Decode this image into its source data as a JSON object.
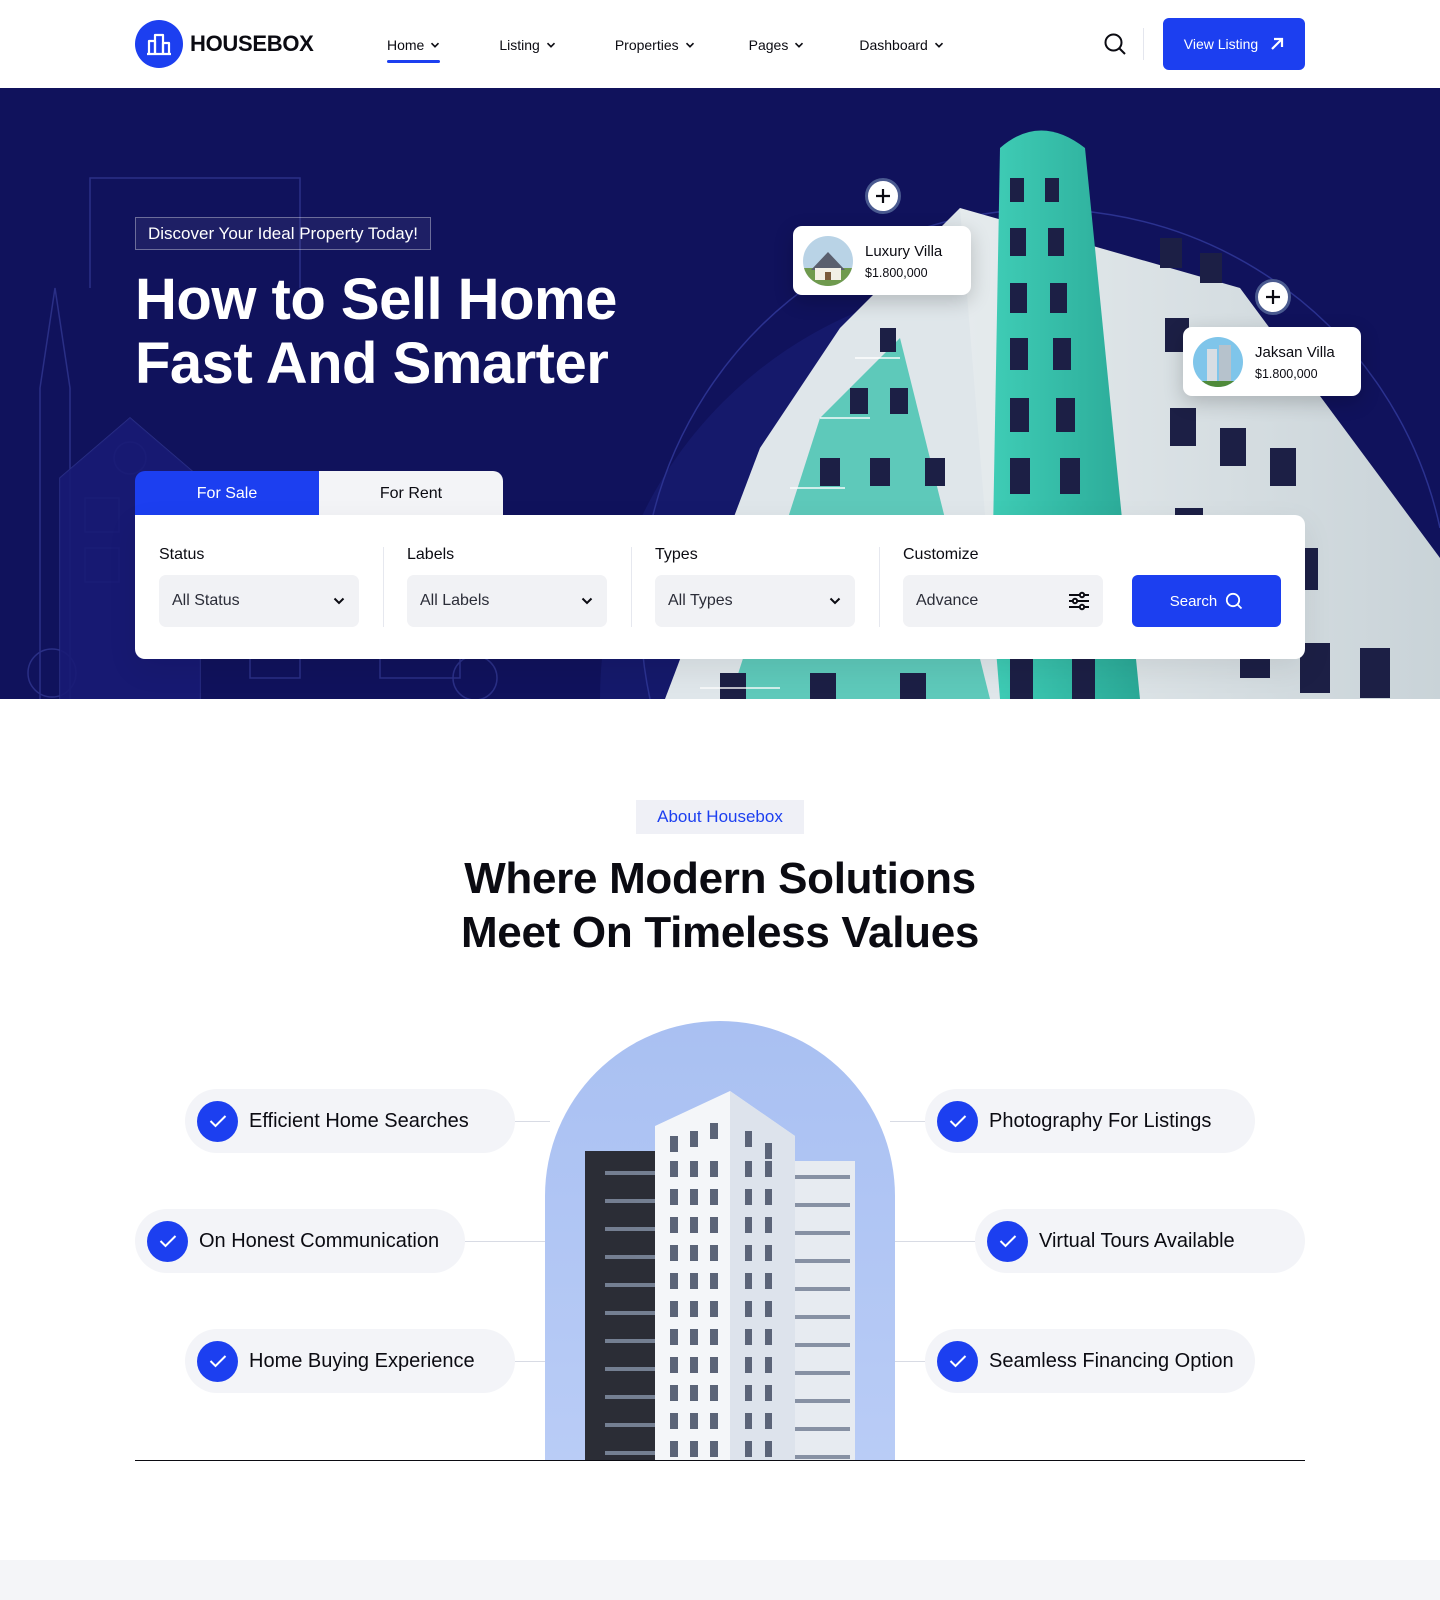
{
  "brand": {
    "name": "HOUSEBOX",
    "accent": "#1c3ff0",
    "hero_bg": "#10125c"
  },
  "nav": {
    "items": [
      {
        "label": "Home",
        "active": true
      },
      {
        "label": "Listing",
        "active": false
      },
      {
        "label": "Properties",
        "active": false
      },
      {
        "label": "Pages",
        "active": false
      },
      {
        "label": "Dashboard",
        "active": false
      }
    ],
    "search_icon": "search-icon",
    "cta_label": "View Listing",
    "cta_icon": "arrow-up-right-icon"
  },
  "hero": {
    "tag": "Discover Your Ideal Property Today!",
    "title_line1": "How to Sell Home",
    "title_line2": "Fast And Smarter",
    "cards": [
      {
        "name": "Luxury Villa",
        "price": "$1.800,000"
      },
      {
        "name": "Jaksan Villa",
        "price": "$1.800,000"
      }
    ]
  },
  "search": {
    "tabs": [
      {
        "label": "For Sale",
        "active": true
      },
      {
        "label": "For Rent",
        "active": false
      }
    ],
    "fields": [
      {
        "label": "Status",
        "value": "All Status",
        "icon": "chevron-down-icon"
      },
      {
        "label": "Labels",
        "value": "All Labels",
        "icon": "chevron-down-icon"
      },
      {
        "label": "Types",
        "value": "All Types",
        "icon": "chevron-down-icon"
      },
      {
        "label": "Customize",
        "value": "Advance",
        "icon": "sliders-icon"
      }
    ],
    "submit_label": "Search"
  },
  "about": {
    "tag": "About Housebox",
    "title_line1": "Where Modern Solutions",
    "title_line2": "Meet On Timeless Values",
    "features_left": [
      "Efficient Home Searches",
      "On Honest Communication",
      "Home Buying Experience"
    ],
    "features_right": [
      "Photography For Listings",
      "Virtual Tours Available",
      "Seamless Financing Option"
    ]
  }
}
